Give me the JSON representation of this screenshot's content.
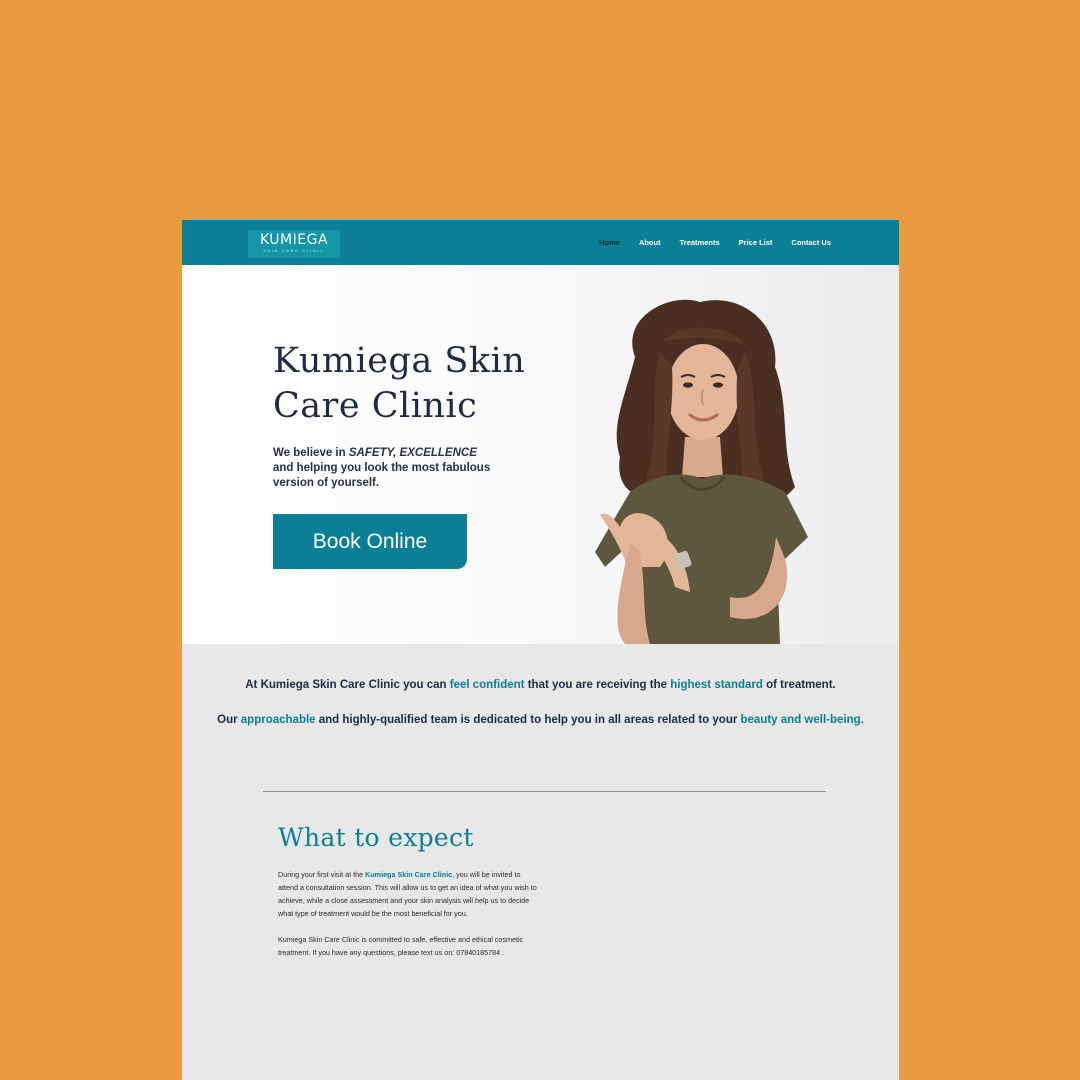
{
  "colors": {
    "page_background": "#E89B3F",
    "brand_teal": "#0A7F96",
    "navy_text": "#1E2B44",
    "section_grey": "#E8E8E8"
  },
  "nav": {
    "logo": {
      "wordmark": "KUMIEGA",
      "subtitle": "Skin Care Clinic"
    },
    "links": [
      {
        "label": "Home",
        "active": true
      },
      {
        "label": "About"
      },
      {
        "label": "Treatments"
      },
      {
        "label": "Price List"
      },
      {
        "label": "Contact Us"
      }
    ]
  },
  "hero": {
    "title": "Kumiega Skin Care Clinic",
    "tagline_prefix": "We believe in ",
    "tagline_emphasis": "SAFETY, EXCELLENCE",
    "tagline_rest": "and helping you look the most fabulous version of yourself.",
    "book_button": "Book Online"
  },
  "intro": {
    "p1": {
      "a": "At Kumiega Skin Care Clinic you can ",
      "b": "feel confident",
      "c": " that you are receiving the ",
      "d": "highest standard",
      "e": " of treatment."
    },
    "p2": {
      "a": "Our ",
      "b": "approachable",
      "c": " and highly-qualified team is dedicated to help you in all areas related to your ",
      "d": "beauty and well-being."
    }
  },
  "expect": {
    "title": "What to expect",
    "p1": {
      "a": "During your first visit at the ",
      "b": "Kumiega Skin Care Clinic",
      "c": ", you will be invited to attend a consultation session. This will allow us to get an idea of what you wish to achieve, while a close assessment and your skin analysis will help us to decide what type of treatment would be the most beneficial for you."
    },
    "p2": "Kumiega Skin Care Clinic is committed to safe, effective and ethical cosmetic treatment. If you have any questions, please text us on: 07840185784 ."
  }
}
